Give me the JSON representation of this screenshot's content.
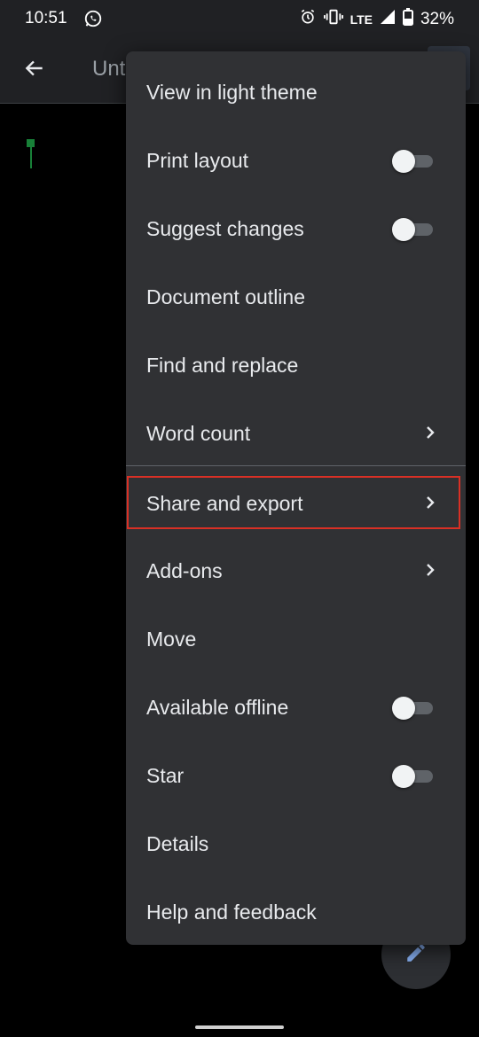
{
  "status_bar": {
    "time": "10:51",
    "network": "LTE",
    "battery": "32%"
  },
  "app_bar": {
    "title": "Unt"
  },
  "menu": {
    "items": [
      {
        "label": "View in light theme"
      },
      {
        "label": "Print layout",
        "toggle": false
      },
      {
        "label": "Suggest changes",
        "toggle": false
      },
      {
        "label": "Document outline"
      },
      {
        "label": "Find and replace"
      },
      {
        "label": "Word count",
        "submenu": true
      },
      {
        "label": "Share and export",
        "submenu": true,
        "highlighted": true
      },
      {
        "label": "Add-ons",
        "submenu": true
      },
      {
        "label": "Move"
      },
      {
        "label": "Available offline",
        "toggle": false
      },
      {
        "label": "Star",
        "toggle": false
      },
      {
        "label": "Details"
      },
      {
        "label": "Help and feedback"
      }
    ]
  },
  "colors": {
    "menu_background": "#303134",
    "highlight_border": "#d93025",
    "cursor": "#188038",
    "fab_icon": "#8ab4f8"
  },
  "icons": [
    "whatsapp-icon",
    "alarm-icon",
    "vibrate-icon",
    "signal-icon",
    "battery-icon",
    "back-arrow-icon",
    "chevron-right-icon",
    "edit-pencil-icon"
  ]
}
